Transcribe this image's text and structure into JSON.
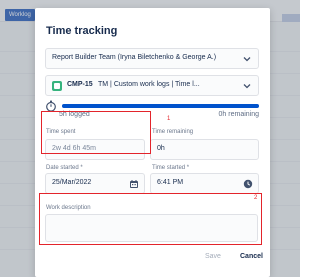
{
  "background": {
    "tab_label": "Worklog"
  },
  "modal": {
    "title": "Time tracking",
    "team_select": "Report Builder Team (Iryna Biletchenko & George A.)",
    "issue": {
      "key": "CMP-15",
      "summary": "TM | Custom work logs | Time l..."
    },
    "progress": {
      "fraction": 1.0,
      "logged": "5h logged",
      "remaining": "0h remaining"
    },
    "time_spent": {
      "label": "Time spent",
      "placeholder": "2w 4d 6h 45m",
      "value": ""
    },
    "time_remaining": {
      "label": "Time remaining",
      "value": "0h"
    },
    "date_started": {
      "label": "Date started *",
      "value": "25/Mar/2022"
    },
    "time_started": {
      "label": "Time started *",
      "value": "6:41 PM"
    },
    "work_description": {
      "label": "Work description",
      "value": ""
    },
    "buttons": {
      "save": "Save",
      "cancel": "Cancel"
    }
  },
  "annotations": {
    "box1_number": "1",
    "box2_number": "2",
    "color": "#e3242b"
  },
  "colors": {
    "accent": "#0052cc",
    "issue_type": "#36b37e"
  },
  "icons": {
    "chevron": "chevron-down-icon",
    "stopwatch": "stopwatch-icon",
    "calendar": "calendar-icon",
    "clock": "clock-icon"
  }
}
